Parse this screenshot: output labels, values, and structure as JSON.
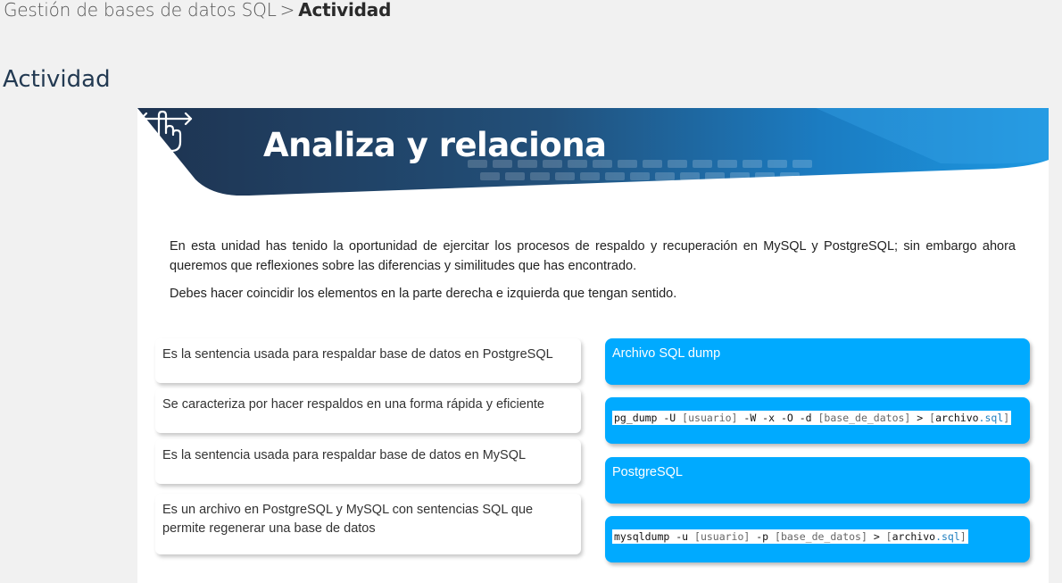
{
  "breadcrumb": {
    "parent": "Gestión de bases de datos SQL",
    "separator": ">",
    "current": "Actividad"
  },
  "page_title": "Actividad",
  "banner": {
    "title": "Analiza y relaciona",
    "icon": "hand-swipe-icon"
  },
  "intro": "En esta unidad has tenido la oportunidad de ejercitar los procesos de respaldo y recuperación en MySQL y PostgreSQL; sin embargo ahora queremos que reflexiones sobre las diferencias y similitudes que has encontrado.",
  "instruction": "Debes hacer coincidir los elementos en la parte derecha e izquierda que tengan sentido.",
  "left_items": [
    "Es la sentencia usada para respaldar base de datos en PostgreSQL",
    "Se caracteriza por hacer respaldos en una forma rápida y eficiente",
    "Es la sentencia usada para respaldar base de datos en MySQL",
    "Es un archivo en PostgreSQL y MySQL con sentencias SQL que permite regenerar una base de datos"
  ],
  "right_items": {
    "item0": "Archivo SQL dump",
    "item1": {
      "cmd": "pg_dump -U ",
      "usuario": "[usuario]",
      "mid": " -W -x -O -d ",
      "db": "[base_de_datos]",
      "gt": " > ",
      "open": "[",
      "file": "archivo",
      "ext": ".sql",
      "close": "]"
    },
    "item2": "PostgreSQL",
    "item3": {
      "cmd": "mysqldump -u ",
      "usuario": "[usuario]",
      "mid": " -p ",
      "db": "[base_de_datos]",
      "gt": " > ",
      "open": "[",
      "file": "archivo",
      "ext": ".sql",
      "close": "]"
    }
  },
  "colors": {
    "banner_dark": "#1e3350",
    "banner_blue": "#1b8ed6",
    "right_item_bg": "#00aaff",
    "page_bg": "#f1f1f1"
  }
}
